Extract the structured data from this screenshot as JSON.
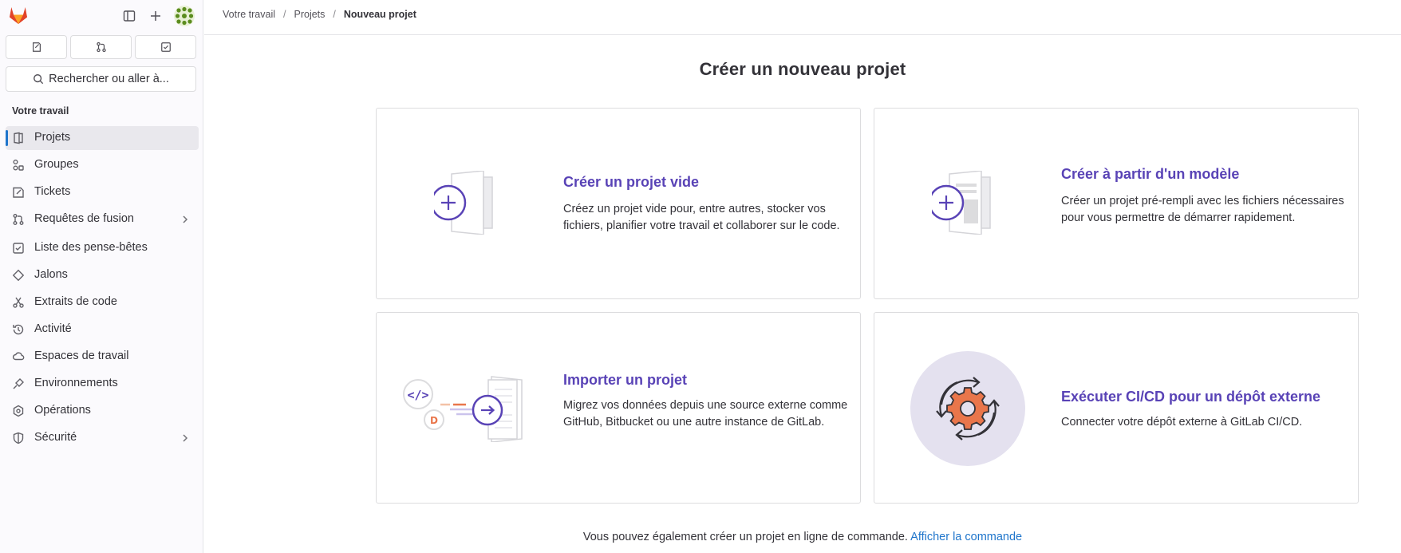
{
  "sidebar": {
    "search_placeholder": "Rechercher ou aller à...",
    "section_title": "Votre travail",
    "items": [
      {
        "label": "Projets",
        "icon": "project-icon",
        "active": true
      },
      {
        "label": "Groupes",
        "icon": "group-icon"
      },
      {
        "label": "Tickets",
        "icon": "issues-icon"
      },
      {
        "label": "Requêtes de fusion",
        "icon": "merge-request-icon",
        "expandable": true
      },
      {
        "label": "Liste des pense-bêtes",
        "icon": "todo-icon"
      },
      {
        "label": "Jalons",
        "icon": "milestone-icon"
      },
      {
        "label": "Extraits de code",
        "icon": "snippet-icon"
      },
      {
        "label": "Activité",
        "icon": "history-icon"
      },
      {
        "label": "Espaces de travail",
        "icon": "workspace-icon"
      },
      {
        "label": "Environnements",
        "icon": "environment-icon"
      },
      {
        "label": "Opérations",
        "icon": "operations-icon"
      },
      {
        "label": "Sécurité",
        "icon": "shield-icon",
        "expandable": true
      }
    ]
  },
  "breadcrumb": [
    "Votre travail",
    "Projets",
    "Nouveau projet"
  ],
  "page": {
    "title": "Créer un nouveau projet",
    "cards": [
      {
        "title": "Créer un projet vide",
        "desc": "Créez un projet vide pour, entre autres, stocker vos fichiers, planifier votre travail et collaborer sur le code."
      },
      {
        "title": "Créer à partir d'un modèle",
        "desc": "Créer un projet pré-rempli avec les fichiers nécessaires pour vous permettre de démarrer rapidement."
      },
      {
        "title": "Importer un projet",
        "desc": "Migrez vos données depuis une source externe comme GitHub, Bitbucket ou une autre instance de GitLab."
      },
      {
        "title": "Exécuter CI/CD pour un dépôt externe",
        "desc": "Connecter votre dépôt externe à GitLab CI/CD."
      }
    ],
    "footer_text": "Vous pouvez également créer un projet en ligne de commande.",
    "footer_link": "Afficher la commande"
  },
  "colors": {
    "accent": "#5943b6",
    "link": "#1f75cb",
    "active_bar": "#1f75cb",
    "gear": "#e9764b"
  }
}
